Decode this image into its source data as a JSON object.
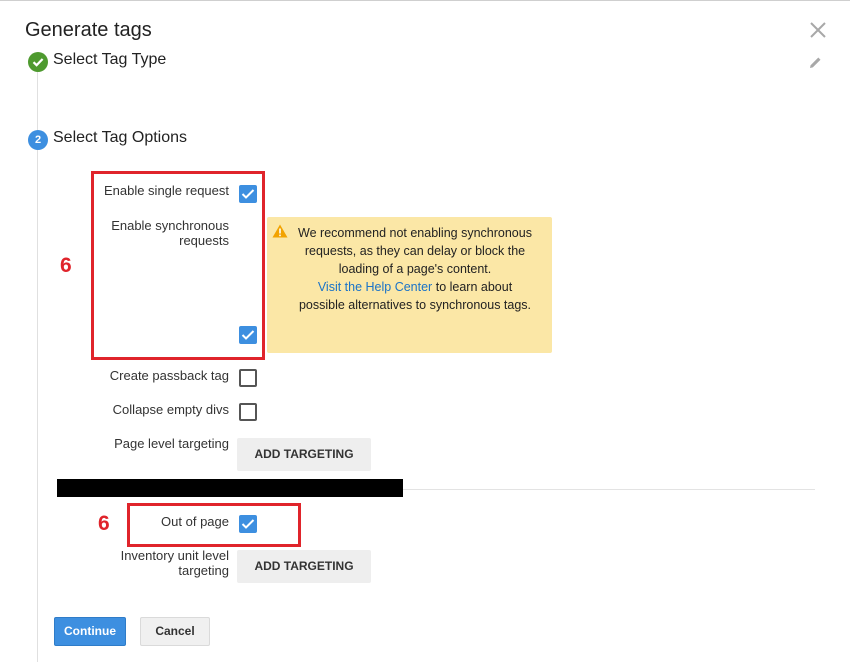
{
  "dialog": {
    "title": "Generate tags"
  },
  "steps": {
    "step1": {
      "title": "Select Tag Type",
      "status": "completed"
    },
    "step2": {
      "number": "2",
      "title": "Select Tag Options"
    }
  },
  "options": {
    "single_request": {
      "label": "Enable single request",
      "checked": true
    },
    "synchronous": {
      "label_line1": "Enable synchronous",
      "label_line2": "requests",
      "checked": true
    },
    "passback": {
      "label": "Create passback tag",
      "checked": false
    },
    "collapse": {
      "label": "Collapse empty divs",
      "checked": false
    },
    "page_targeting": {
      "label": "Page level targeting",
      "button": "ADD TARGETING"
    },
    "out_of_page": {
      "label": "Out of page",
      "checked": true
    },
    "inventory_targeting": {
      "label_line1": "Inventory unit level",
      "label_line2": "targeting",
      "button": "ADD TARGETING"
    }
  },
  "warning": {
    "icon": "warning-icon",
    "text_part1": "We recommend not enabling synchronous requests, as they can delay or block the loading of a page's content.",
    "link": "Visit the Help Center",
    "text_part2": "to learn about possible alternatives to synchronous tags."
  },
  "annotations": {
    "marker1": "6",
    "marker2": "6"
  },
  "footer": {
    "continue": "Continue",
    "cancel": "Cancel"
  },
  "colors": {
    "accent": "#3d8fe0",
    "success": "#4e9a2f",
    "warning_bg": "#fbe7a6",
    "annotation_red": "#e0242b"
  }
}
